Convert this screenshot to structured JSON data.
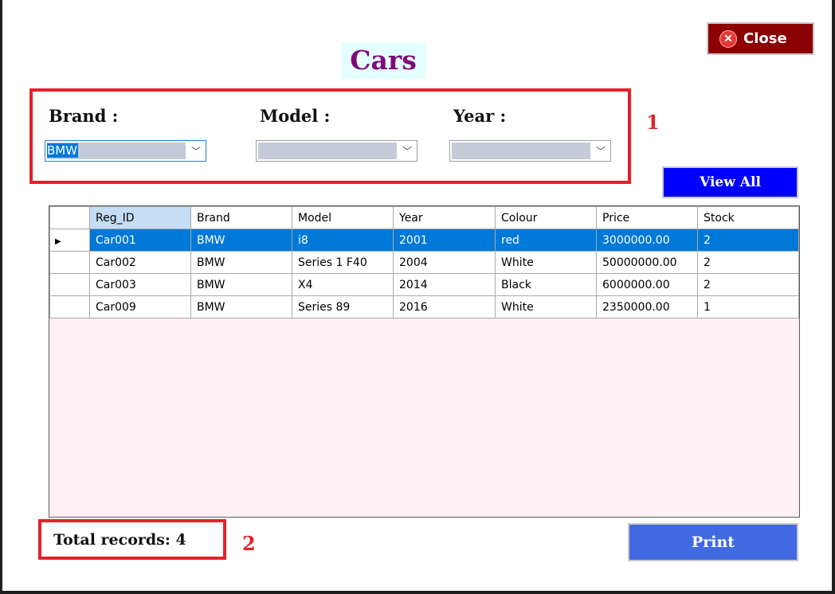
{
  "window": {
    "title": "Cars",
    "close_label": "Close"
  },
  "filters": {
    "brand_label": "Brand :",
    "model_label": "Model :",
    "year_label": "Year :",
    "brand_value": "BMW",
    "model_value": "",
    "year_value": ""
  },
  "callouts": {
    "one": "1",
    "two": "2"
  },
  "buttons": {
    "view_all": "View All",
    "print": "Print"
  },
  "grid": {
    "columns": [
      "Reg_ID",
      "Brand",
      "Model",
      "Year",
      "Colour",
      "Price",
      "Stock"
    ],
    "rows": [
      [
        "Car001",
        "BMW",
        "i8",
        "2001",
        "red",
        "3000000.00",
        "2"
      ],
      [
        "Car002",
        "BMW",
        "Series 1 F40",
        "2004",
        "White",
        "50000000.00",
        "2"
      ],
      [
        "Car003",
        "BMW",
        "X4",
        "2014",
        "Black",
        "6000000.00",
        "2"
      ],
      [
        "Car009",
        "BMW",
        "Series 89",
        "2016",
        "White",
        "2350000.00",
        "1"
      ]
    ],
    "selected_row": 0,
    "sorted_column": 0
  },
  "footer": {
    "total_records": "Total records: 4"
  },
  "colors": {
    "title_text": "#7d0b7d",
    "title_bg": "#e4ffff",
    "close_bg": "#8b0000",
    "callout": "#e3222a",
    "view_all_bg": "#0000ff",
    "print_bg": "#4169e1",
    "selection": "#0078d7",
    "grid_bg": "#fff0f5"
  }
}
